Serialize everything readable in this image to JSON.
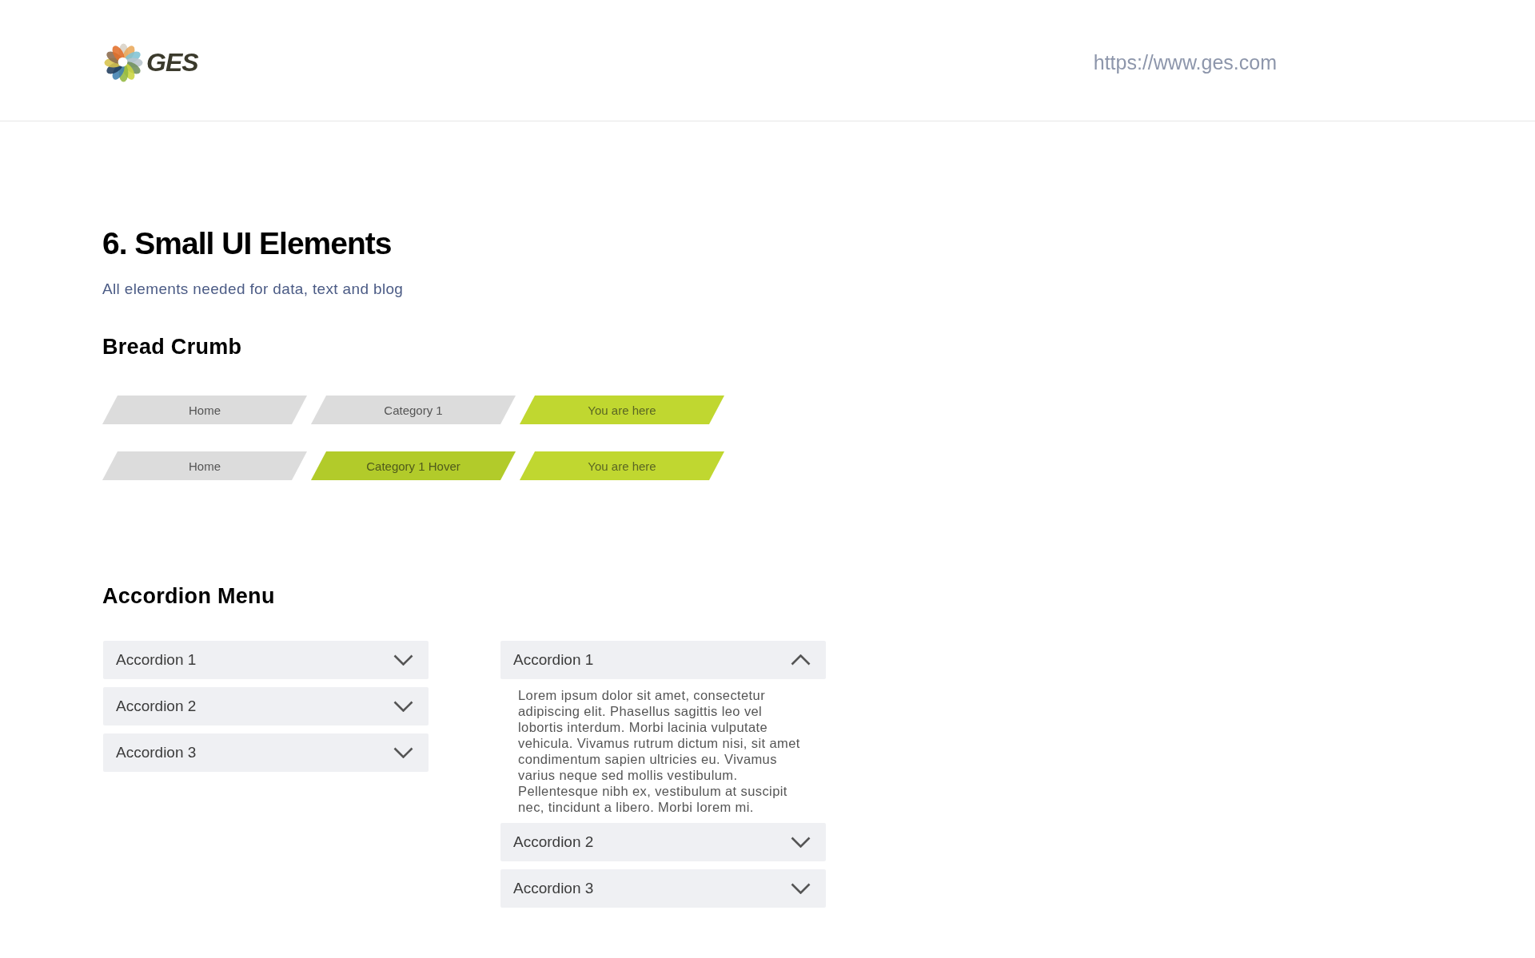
{
  "header": {
    "logo_text": "GES",
    "url": "https://www.ges.com"
  },
  "page": {
    "title": "6. Small UI Elements",
    "subtitle": "All elements needed for data, text and blog"
  },
  "breadcrumb_section": {
    "heading": "Bread Crumb",
    "rows": [
      {
        "items": [
          {
            "label": "Home",
            "hovered": false,
            "current": false
          },
          {
            "label": "Category 1",
            "hovered": false,
            "current": false
          },
          {
            "label": "You are here",
            "hovered": false,
            "current": true
          }
        ]
      },
      {
        "items": [
          {
            "label": "Home",
            "hovered": false,
            "current": false
          },
          {
            "label": "Category 1 Hover",
            "hovered": true,
            "current": false
          },
          {
            "label": "You are here",
            "hovered": false,
            "current": true
          }
        ]
      }
    ]
  },
  "accordion_section": {
    "heading": "Accordion Menu",
    "menus": [
      {
        "items": [
          {
            "title": "Accordion 1",
            "expanded": false
          },
          {
            "title": "Accordion 2",
            "expanded": false
          },
          {
            "title": "Accordion 3",
            "expanded": false
          }
        ]
      },
      {
        "items": [
          {
            "title": "Accordion 1",
            "expanded": true,
            "body": "Lorem ipsum dolor sit amet, consectetur adipiscing elit. Phasellus sagittis leo vel lobortis interdum. Morbi lacinia vulputate vehicula. Vivamus rutrum dictum nisi, sit amet condimentum sapien ultricies eu. Vivamus varius neque sed mollis vestibulum. Pellentesque nibh ex, vestibulum at suscipit nec, tincidunt a libero. Morbi lorem mi."
          },
          {
            "title": "Accordion 2",
            "expanded": false
          },
          {
            "title": "Accordion 3",
            "expanded": false
          }
        ]
      }
    ]
  }
}
